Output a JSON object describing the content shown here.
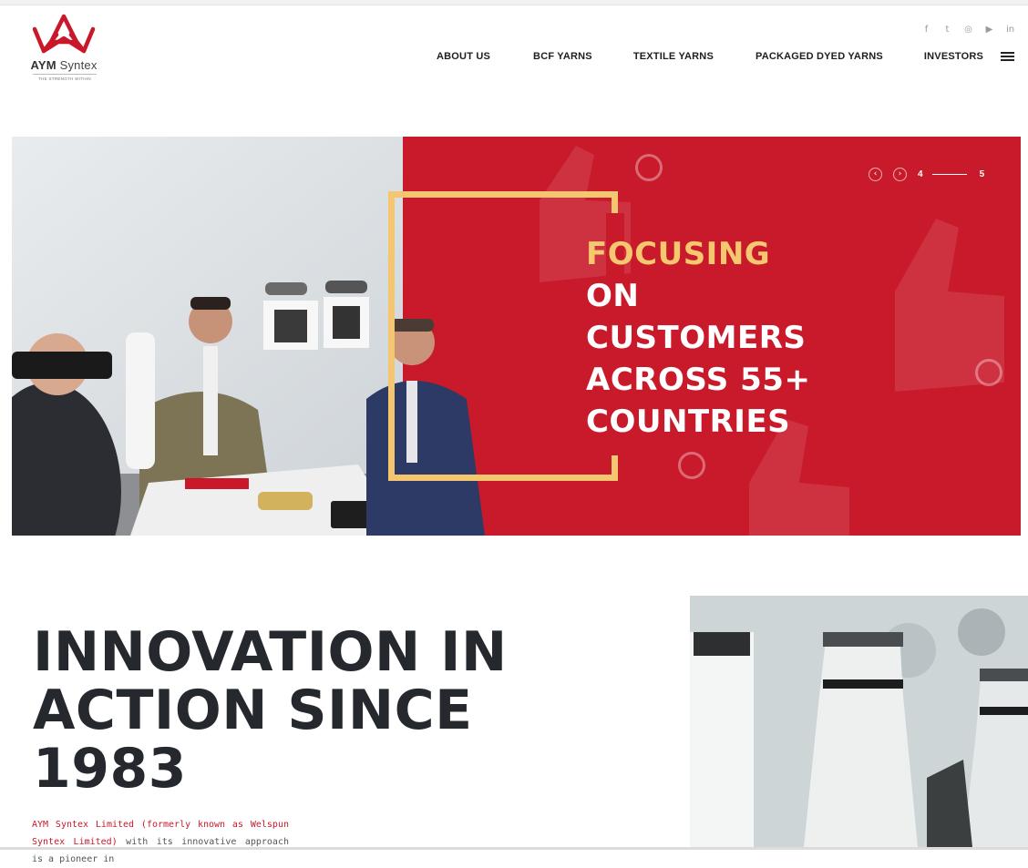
{
  "brand": {
    "name_bold": "AYM",
    "name_light": " Syntex",
    "tagline": "THE STRENGTH WITHIN",
    "logo_color": "#c8182a"
  },
  "social": [
    {
      "icon": "facebook-icon",
      "glyph": "f"
    },
    {
      "icon": "twitter-icon",
      "glyph": "t"
    },
    {
      "icon": "instagram-icon",
      "glyph": "◎"
    },
    {
      "icon": "youtube-icon",
      "glyph": "▶"
    },
    {
      "icon": "linkedin-icon",
      "glyph": "in"
    }
  ],
  "nav": {
    "items": [
      {
        "label": "ABOUT US"
      },
      {
        "label": "BCF YARNS"
      },
      {
        "label": "TEXTILE YARNS"
      },
      {
        "label": "PACKAGED DYED YARNS"
      },
      {
        "label": "INVESTORS"
      }
    ],
    "menu_icon": "hamburger-menu-icon"
  },
  "hero": {
    "line1": "FOCUSING",
    "line2": "ON",
    "line3": "CUSTOMERS",
    "line4": "ACROSS 55+",
    "line5": "COUNTRIES",
    "current_slide": "4",
    "next_slide": "5",
    "prev_glyph": "‹",
    "next_glyph": "›",
    "accent_color": "#f5c86f",
    "panel_color": "#c91a2b"
  },
  "innovation": {
    "line1": "INNOVATION IN",
    "line2": "ACTION SINCE",
    "line3": "1983",
    "intro_red": "AYM Syntex Limited (formerly known as Welspun Syntex Limited)",
    "intro_rest": " with its innovative approach is a pioneer in"
  }
}
